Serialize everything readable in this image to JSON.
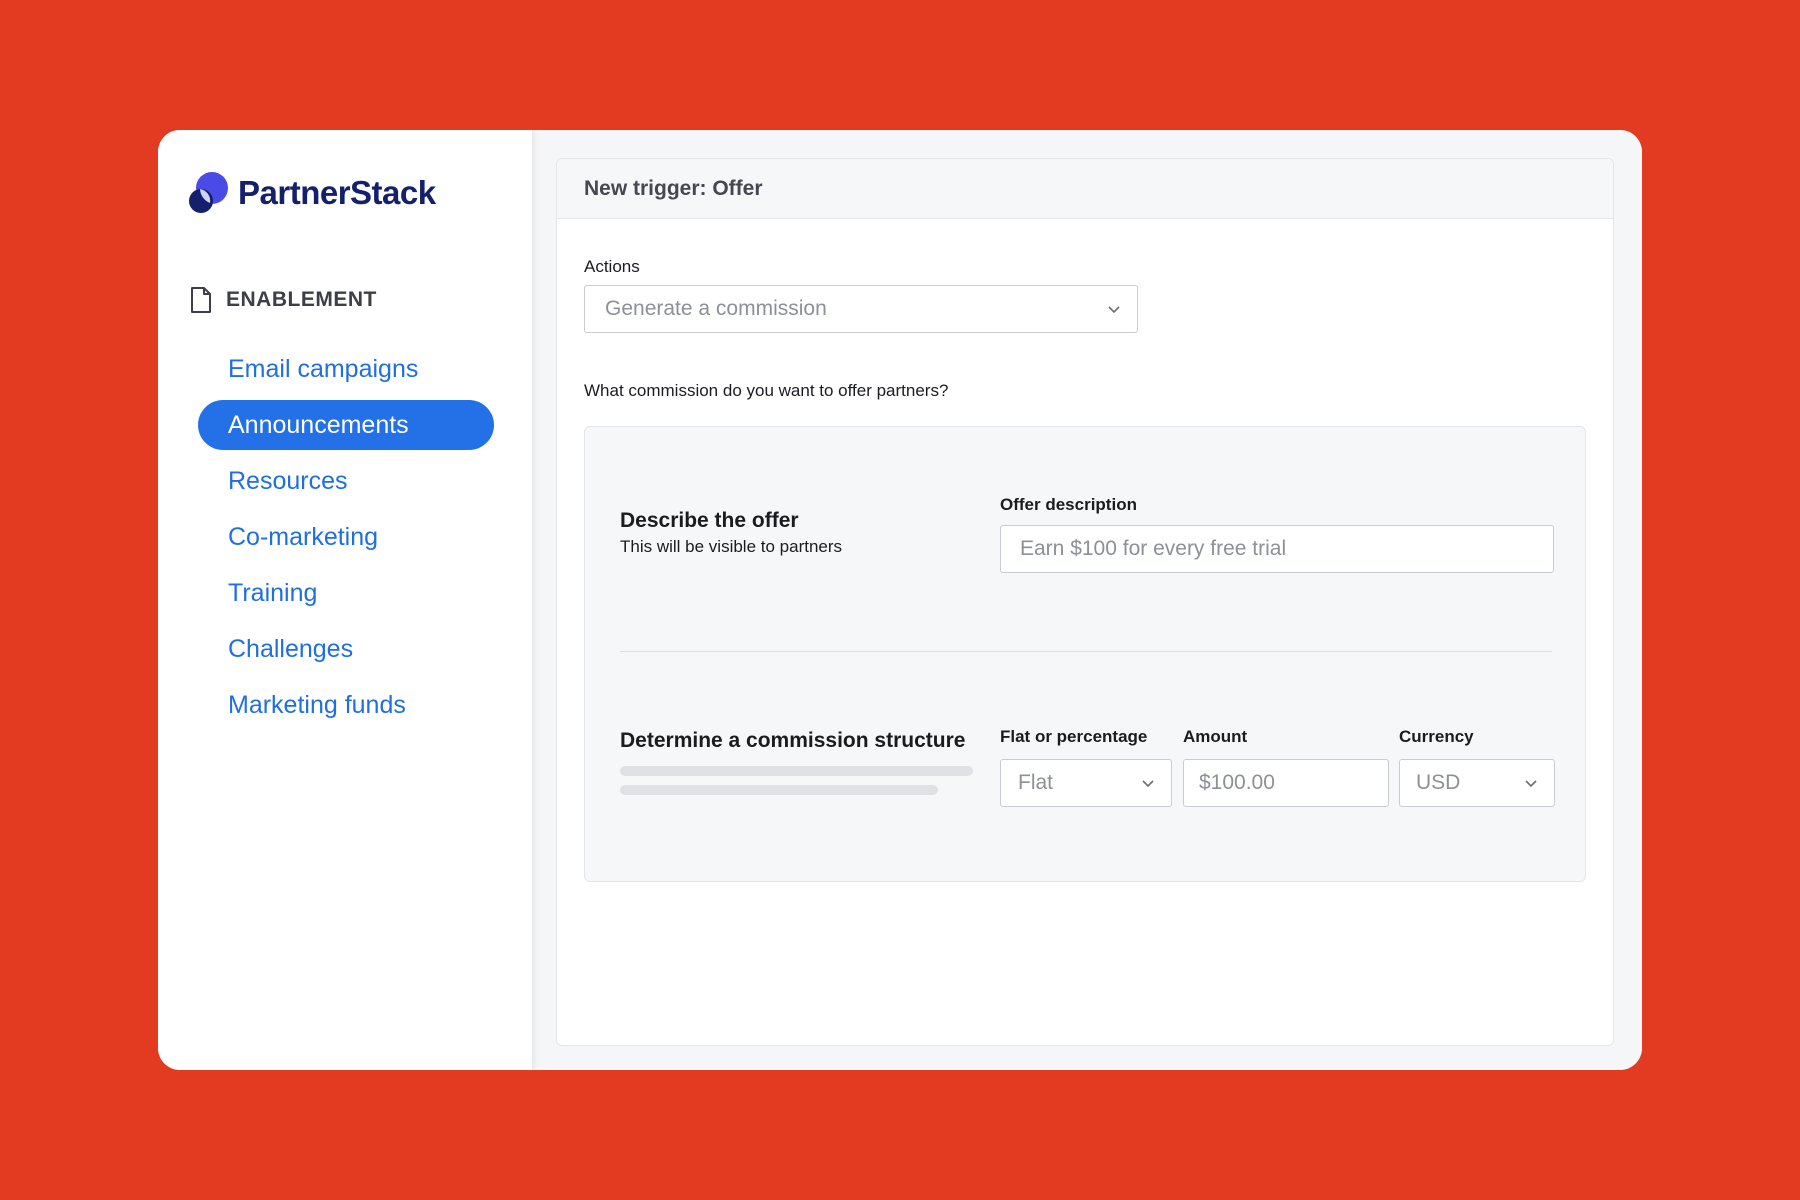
{
  "brand": {
    "name": "PartnerStack"
  },
  "sidebar": {
    "section_label": "ENABLEMENT",
    "items": [
      {
        "label": "Email campaigns",
        "active": false
      },
      {
        "label": "Announcements",
        "active": true
      },
      {
        "label": "Resources",
        "active": false
      },
      {
        "label": "Co-marketing",
        "active": false
      },
      {
        "label": "Training",
        "active": false
      },
      {
        "label": "Challenges",
        "active": false
      },
      {
        "label": "Marketing funds",
        "active": false
      }
    ]
  },
  "panel": {
    "title": "New trigger: Offer",
    "actions_label": "Actions",
    "actions_value": "Generate a commission",
    "question": "What commission do you want to offer partners?",
    "offer": {
      "title": "Describe the offer",
      "subtitle": "This will be visible to partners",
      "description_label": "Offer description",
      "description_placeholder": "Earn $100 for every free trial"
    },
    "commission": {
      "title": "Determine a commission structure",
      "type_label": "Flat or percentage",
      "type_value": "Flat",
      "amount_label": "Amount",
      "amount_placeholder": "$100.00",
      "currency_label": "Currency",
      "currency_value": "USD"
    }
  },
  "colors": {
    "background": "#e33a22",
    "accent": "#2470e6",
    "link": "#1f6fde",
    "brand_dark": "#14206b"
  }
}
